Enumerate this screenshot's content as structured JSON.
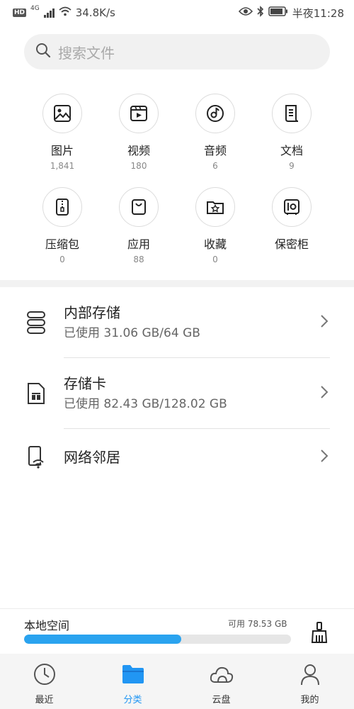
{
  "status_bar": {
    "network_badge": "HD",
    "network_type": "4G",
    "speed": "34.8K/s",
    "time": "半夜11:28"
  },
  "search": {
    "placeholder": "搜索文件"
  },
  "categories": [
    {
      "label": "图片",
      "count": "1,841",
      "icon": "image-icon"
    },
    {
      "label": "视频",
      "count": "180",
      "icon": "video-icon"
    },
    {
      "label": "音频",
      "count": "6",
      "icon": "music-icon"
    },
    {
      "label": "文档",
      "count": "9",
      "icon": "document-icon"
    },
    {
      "label": "压缩包",
      "count": "0",
      "icon": "zip-icon"
    },
    {
      "label": "应用",
      "count": "88",
      "icon": "shopping-bag-icon"
    },
    {
      "label": "收藏",
      "count": "0",
      "icon": "star-folder-icon"
    },
    {
      "label": "保密柜",
      "count": "",
      "icon": "safe-icon"
    }
  ],
  "storage": [
    {
      "title": "内部存储",
      "subtitle": "已使用 31.06 GB/64 GB",
      "icon": "server-icon"
    },
    {
      "title": "存储卡",
      "subtitle": "已使用 82.43 GB/128.02 GB",
      "icon": "sd-card-icon"
    },
    {
      "title": "网络邻居",
      "subtitle": "",
      "icon": "network-phone-icon"
    }
  ],
  "space": {
    "title": "本地空间",
    "free": "可用 78.53 GB",
    "used_fraction": 0.59
  },
  "nav": [
    {
      "label": "最近",
      "icon": "clock-icon",
      "active": false
    },
    {
      "label": "分类",
      "icon": "folder-icon",
      "active": true
    },
    {
      "label": "云盘",
      "icon": "cloud-icon",
      "active": false
    },
    {
      "label": "我的",
      "icon": "person-icon",
      "active": false
    }
  ],
  "colors": {
    "accent": "#2196f3",
    "progress": "#2aa3ef"
  }
}
